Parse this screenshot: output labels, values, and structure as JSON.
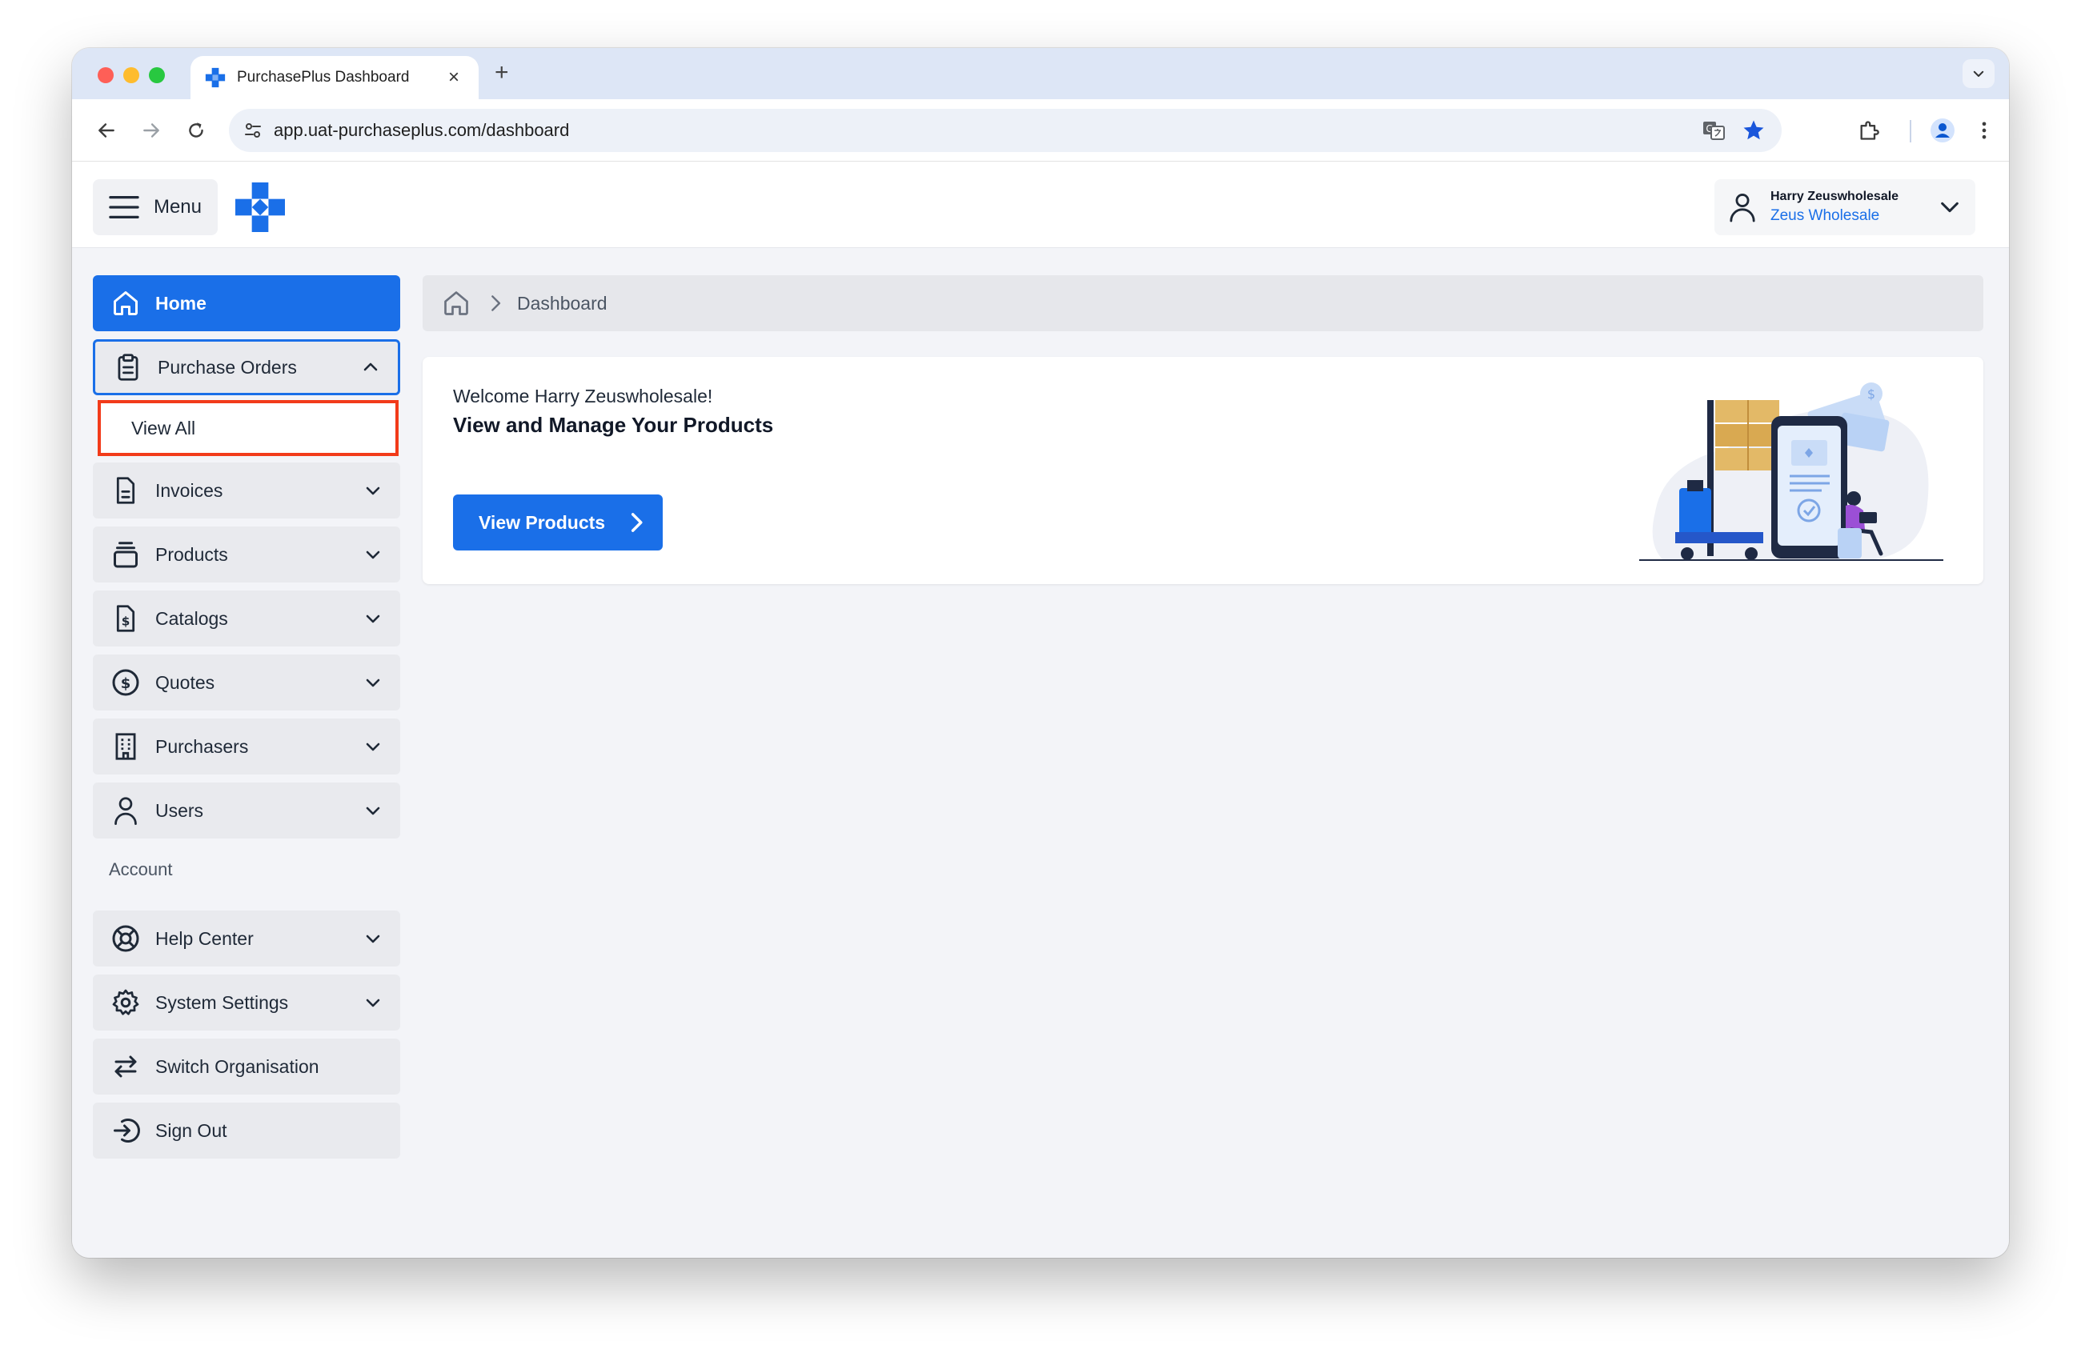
{
  "browser": {
    "tab_title": "PurchasePlus Dashboard",
    "tab_close": "×",
    "new_tab": "+",
    "url": "app.uat-purchaseplus.com/dashboard"
  },
  "header": {
    "menu_label": "Menu",
    "user_name": "Harry Zeuswholesale",
    "organisation": "Zeus Wholesale"
  },
  "sidebar": {
    "items": [
      {
        "label": "Home"
      },
      {
        "label": "Purchase Orders"
      },
      {
        "label": "View All"
      },
      {
        "label": "Invoices"
      },
      {
        "label": "Products"
      },
      {
        "label": "Catalogs"
      },
      {
        "label": "Quotes"
      },
      {
        "label": "Purchasers"
      },
      {
        "label": "Users"
      }
    ],
    "account_label": "Account",
    "account_items": [
      {
        "label": "Help Center"
      },
      {
        "label": "System Settings"
      },
      {
        "label": "Switch Organisation"
      },
      {
        "label": "Sign Out"
      }
    ]
  },
  "breadcrumb": {
    "current": "Dashboard"
  },
  "welcome": {
    "greeting": "Welcome Harry Zeuswholesale!",
    "heading": "View and Manage Your Products",
    "button_label": "View Products"
  },
  "colors": {
    "primary": "#1a6fe8",
    "highlight_outline": "#f23b1a",
    "sidebar_item_bg": "#e9eaee",
    "page_bg": "#f3f4f8"
  }
}
